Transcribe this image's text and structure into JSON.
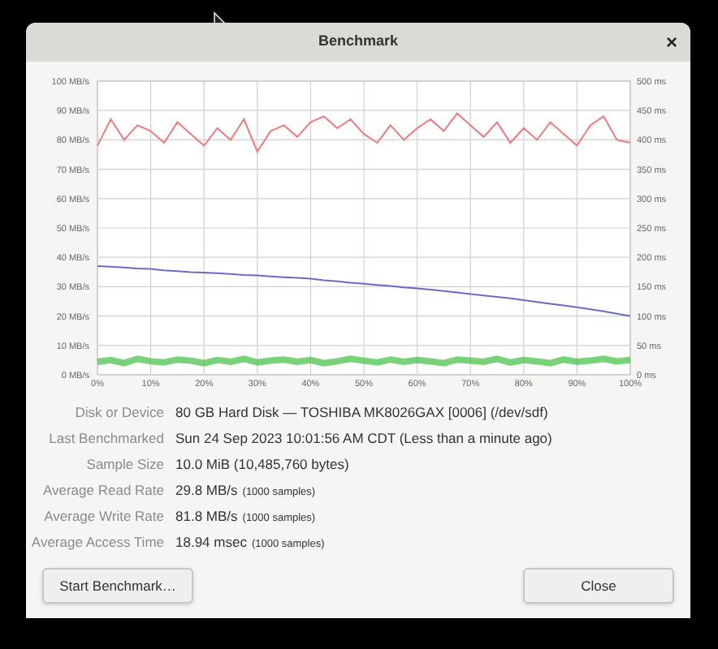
{
  "window": {
    "title": "Benchmark",
    "close": "×"
  },
  "chart_data": {
    "type": "line",
    "grid": true,
    "xlim": [
      0,
      100
    ],
    "ylim": [
      0,
      100
    ],
    "y2lim": [
      0,
      500
    ],
    "xticks": [
      {
        "value": 0,
        "label": "0%"
      },
      {
        "value": 10,
        "label": "10%"
      },
      {
        "value": 20,
        "label": "20%"
      },
      {
        "value": 30,
        "label": "30%"
      },
      {
        "value": 40,
        "label": "40%"
      },
      {
        "value": 50,
        "label": "50%"
      },
      {
        "value": 60,
        "label": "60%"
      },
      {
        "value": 70,
        "label": "70%"
      },
      {
        "value": 80,
        "label": "80%"
      },
      {
        "value": 90,
        "label": "90%"
      },
      {
        "value": 100,
        "label": "100%"
      }
    ],
    "yticks": [
      {
        "value": 0,
        "label": "0 MB/s"
      },
      {
        "value": 10,
        "label": "10 MB/s"
      },
      {
        "value": 20,
        "label": "20 MB/s"
      },
      {
        "value": 30,
        "label": "30 MB/s"
      },
      {
        "value": 40,
        "label": "40 MB/s"
      },
      {
        "value": 50,
        "label": "50 MB/s"
      },
      {
        "value": 60,
        "label": "60 MB/s"
      },
      {
        "value": 70,
        "label": "70 MB/s"
      },
      {
        "value": 80,
        "label": "80 MB/s"
      },
      {
        "value": 90,
        "label": "90 MB/s"
      },
      {
        "value": 100,
        "label": "100 MB/s"
      }
    ],
    "y2ticks": [
      {
        "value": 0,
        "label": "0 ms"
      },
      {
        "value": 50,
        "label": "50 ms"
      },
      {
        "value": 100,
        "label": "100 ms"
      },
      {
        "value": 150,
        "label": "150 ms"
      },
      {
        "value": 200,
        "label": "200 ms"
      },
      {
        "value": 250,
        "label": "250 ms"
      },
      {
        "value": 300,
        "label": "300 ms"
      },
      {
        "value": 350,
        "label": "350 ms"
      },
      {
        "value": 400,
        "label": "400 ms"
      },
      {
        "value": 450,
        "label": "450 ms"
      },
      {
        "value": 500,
        "label": "500 ms"
      }
    ],
    "x": [
      0,
      2.5,
      5,
      7.5,
      10,
      12.5,
      15,
      17.5,
      20,
      22.5,
      25,
      27.5,
      30,
      32.5,
      35,
      37.5,
      40,
      42.5,
      45,
      47.5,
      50,
      52.5,
      55,
      57.5,
      60,
      62.5,
      65,
      67.5,
      70,
      72.5,
      75,
      77.5,
      80,
      82.5,
      85,
      87.5,
      90,
      92.5,
      95,
      97.5,
      100
    ],
    "series": [
      {
        "color": "#ef7b7b",
        "values": [
          78,
          87,
          80,
          85,
          83,
          79,
          86,
          82,
          78,
          84,
          80,
          87,
          76,
          83,
          85,
          81,
          86,
          88,
          84,
          87,
          82,
          79,
          85,
          80,
          84,
          87,
          83,
          89,
          85,
          81,
          86,
          79,
          84,
          80,
          86,
          82,
          78,
          85,
          88,
          80,
          79
        ]
      },
      {
        "color": "#6b6bc4",
        "values": [
          37,
          36.8,
          36.5,
          36.2,
          36,
          35.6,
          35.3,
          35,
          34.8,
          34.6,
          34.3,
          34,
          33.8,
          33.5,
          33.2,
          33,
          32.7,
          32.2,
          31.8,
          31.4,
          31,
          30.6,
          30.2,
          29.8,
          29.4,
          29,
          28.5,
          28,
          27.5,
          27,
          26.5,
          26,
          25.4,
          24.8,
          24.2,
          23.6,
          23,
          22.3,
          21.6,
          20.8,
          20
        ]
      },
      {
        "color": "#3fbf3f",
        "axis": "y2",
        "values": [
          22,
          25,
          20,
          27,
          23,
          21,
          26,
          24,
          20,
          25,
          22,
          27,
          21,
          24,
          26,
          22,
          25,
          20,
          23,
          27,
          24,
          21,
          26,
          22,
          25,
          23,
          20,
          26,
          24,
          22,
          27,
          21,
          25,
          23,
          20,
          26,
          22,
          24,
          27,
          23,
          25
        ]
      }
    ]
  },
  "details": [
    {
      "label": "Disk or Device",
      "value": "80 GB Hard Disk — TOSHIBA MK8026GAX [0006] (/dev/sdf)"
    },
    {
      "label": "Last Benchmarked",
      "value": "Sun 24 Sep 2023 10:01:56 AM CDT (Less than a minute ago)"
    },
    {
      "label": "Sample Size",
      "value": "10.0 MiB (10,485,760 bytes)"
    },
    {
      "label": "Average Read Rate",
      "value": "29.8 MB/s",
      "note": "(1000 samples)"
    },
    {
      "label": "Average Write Rate",
      "value": "81.8 MB/s",
      "note": "(1000 samples)"
    },
    {
      "label": "Average Access Time",
      "value": "18.94 msec",
      "note": "(1000 samples)"
    }
  ],
  "buttons": [
    "Start Benchmark…",
    "Close"
  ]
}
